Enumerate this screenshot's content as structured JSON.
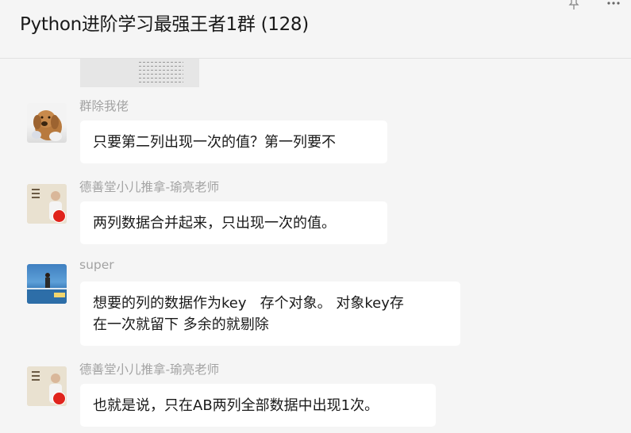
{
  "header": {
    "title": "Python进阶学习最强王者1群 (128)"
  },
  "messages": [
    {
      "sender": "群除我佬",
      "text": "只要第二列出现一次的值？第一列要不",
      "avatar": "dog-avatar"
    },
    {
      "sender": "德善堂小儿推拿-瑜亮老师",
      "text": "两列数据合并起来，只出现一次的值。",
      "avatar": "doctor-avatar"
    },
    {
      "sender": "super",
      "text": "想要的列的数据作为key   存个对象。 对象key存\n在一次就留下 多余的就剔除",
      "avatar": "sea-avatar"
    },
    {
      "sender": "德善堂小儿推拿-瑜亮老师",
      "text": "也就是说，只在AB两列全部数据中出现1次。",
      "avatar": "doctor-avatar"
    }
  ],
  "colors": {
    "background": "#f5f5f5",
    "bubble": "#ffffff",
    "sender_name": "#a3a3a3",
    "text": "#1a1a1a"
  }
}
